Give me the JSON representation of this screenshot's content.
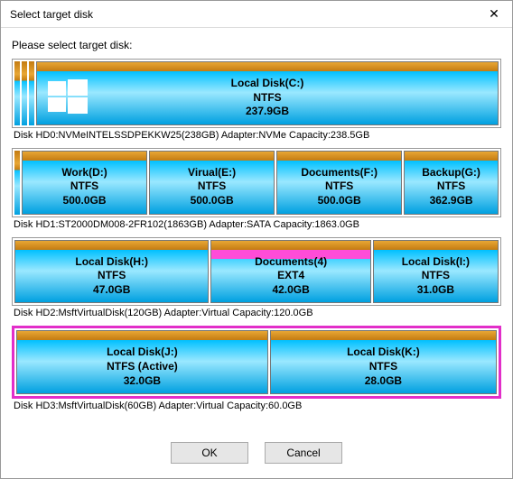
{
  "window": {
    "title": "Select target disk"
  },
  "prompt": "Please select target disk:",
  "disks": [
    {
      "info": "Disk HD0:NVMeINTELSSDPEKKW25(238GB)  Adapter:NVMe  Capacity:238.5GB",
      "selected": false,
      "slivers": 3,
      "showWinLogo": true,
      "partitions": [
        {
          "name": "Local Disk(C:)",
          "fs": "NTFS",
          "size": "237.9GB",
          "flex": 1
        }
      ]
    },
    {
      "info": "Disk HD1:ST2000DM008-2FR102(1863GB)  Adapter:SATA  Capacity:1863.0GB",
      "selected": false,
      "slivers": 1,
      "partitions": [
        {
          "name": "Work(D:)",
          "fs": "NTFS",
          "size": "500.0GB",
          "flex": 1
        },
        {
          "name": "Virual(E:)",
          "fs": "NTFS",
          "size": "500.0GB",
          "flex": 1
        },
        {
          "name": "Documents(F:)",
          "fs": "NTFS",
          "size": "500.0GB",
          "flex": 1
        },
        {
          "name": "Backup(G:)",
          "fs": "NTFS",
          "size": "362.9GB",
          "flex": 0.75
        }
      ]
    },
    {
      "info": "Disk HD2:MsftVirtualDisk(120GB)  Adapter:Virtual  Capacity:120.0GB",
      "selected": false,
      "slivers": 0,
      "partitions": [
        {
          "name": "Local Disk(H:)",
          "fs": "NTFS",
          "size": "47.0GB",
          "flex": 1.4
        },
        {
          "name": "Documents(4)",
          "fs": "EXT4",
          "size": "42.0GB",
          "flex": 1.15,
          "ext4": true
        },
        {
          "name": "Local Disk(I:)",
          "fs": "NTFS",
          "size": "31.0GB",
          "flex": 0.9
        }
      ]
    },
    {
      "info": "Disk HD3:MsftVirtualDisk(60GB)  Adapter:Virtual  Capacity:60.0GB",
      "selected": true,
      "slivers": 0,
      "partitions": [
        {
          "name": "Local Disk(J:)",
          "fs": "NTFS (Active)",
          "size": "32.0GB",
          "flex": 1
        },
        {
          "name": "Local Disk(K:)",
          "fs": "NTFS",
          "size": "28.0GB",
          "flex": 0.9
        }
      ]
    }
  ],
  "buttons": {
    "ok": "OK",
    "cancel": "Cancel"
  }
}
